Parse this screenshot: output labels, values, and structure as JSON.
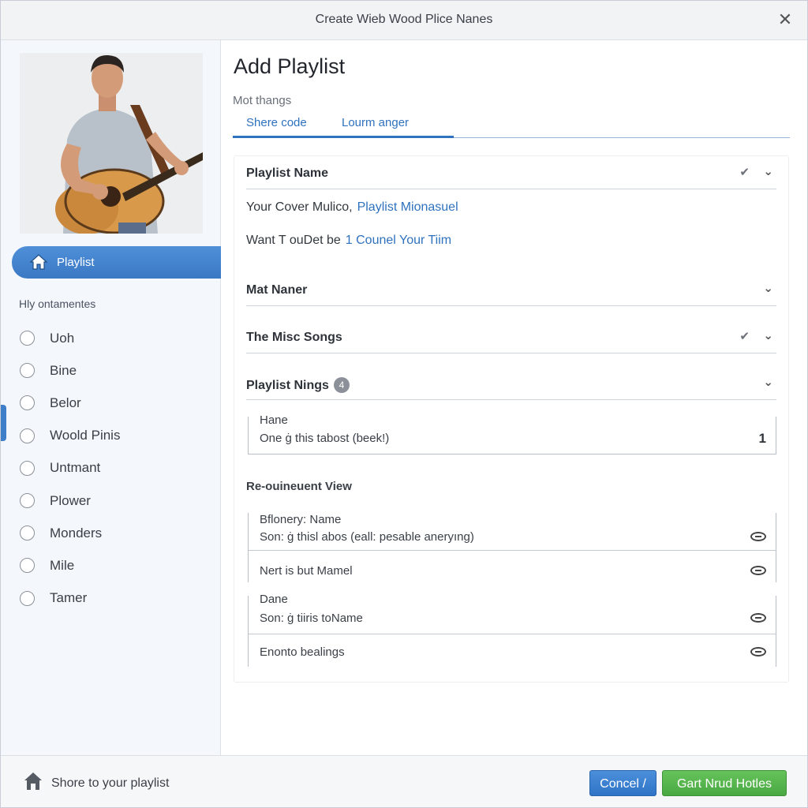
{
  "window": {
    "title": "Create Wieb Wood Plice Nanes"
  },
  "sidebar": {
    "active_item": "Playlist",
    "section_label": "Hly ontamentes",
    "items": [
      "Uoh",
      "Bine",
      "Belor",
      "Woold Pinis",
      "Untmant",
      "Plower",
      "Monders",
      "Mile",
      "Tamer"
    ]
  },
  "main": {
    "heading": "Add Playlist",
    "subtext": "Mot thangs",
    "tabs": [
      "Shere code",
      "Lourm anger"
    ],
    "sections": {
      "playlist_name": "Playlist Name",
      "line1_text": "Your Cover Mulico,",
      "line1_link": "Playlist Mionasuel",
      "line2_text": "Want  T ouDet be",
      "line2_link": "1 Counel Your Tiim",
      "mat_naner": "Mat Naner",
      "misc_songs": "The Misc Songs",
      "playlist_nings": "Playlist Nings",
      "playlist_nings_badge": "4"
    },
    "box1": {
      "label": "Hane",
      "text": "One ġ this tabost (beek!)",
      "count": "1"
    },
    "subheading": "Re-ouineuent View",
    "rows": {
      "r1_label": "Bflonery: Name",
      "r1_text": "Son: ġ thisl abos (eall: pesable aneryıng)",
      "r2_text": "Nert is but Mamel",
      "r3_label": "Dane",
      "r3_text": "Son: ġ tiiris toName",
      "r4_text": "Enonto bealings"
    }
  },
  "footer": {
    "share_text": "Shore to your playlist",
    "cancel_label": "Concel /",
    "primary_label": "Gart Nrud Hotles"
  },
  "colors": {
    "accent": "#3a78c4",
    "primary_button": "#4aa843",
    "link": "#2f72be"
  }
}
